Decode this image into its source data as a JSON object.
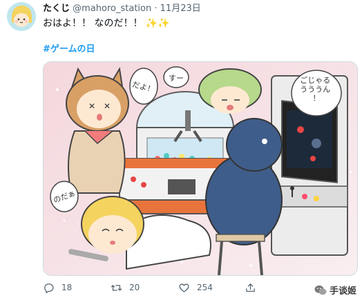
{
  "author": {
    "display_name": "たくじ",
    "handle": "@mahoro_station",
    "separator": "·",
    "date": "11月23日"
  },
  "tweet": {
    "text": "おはよ！！ なのだ！！",
    "emoji": "✨✨",
    "hashtag": "#ゲームの日"
  },
  "illustration": {
    "bubble_1": "だよ！",
    "bubble_2": "すー",
    "bubble_3": "ごじゃる\nうううん\n！",
    "bubble_4": "のだぁ"
  },
  "actions": {
    "reply_count": "18",
    "retweet_count": "20",
    "like_count": "254"
  },
  "icons": [
    "reply-icon",
    "retweet-icon",
    "like-icon",
    "share-icon"
  ],
  "watermark": {
    "text": "手谈姬"
  },
  "colors": {
    "link": "#1d9bf0",
    "secondary": "#536471",
    "primary": "#0f1419"
  }
}
